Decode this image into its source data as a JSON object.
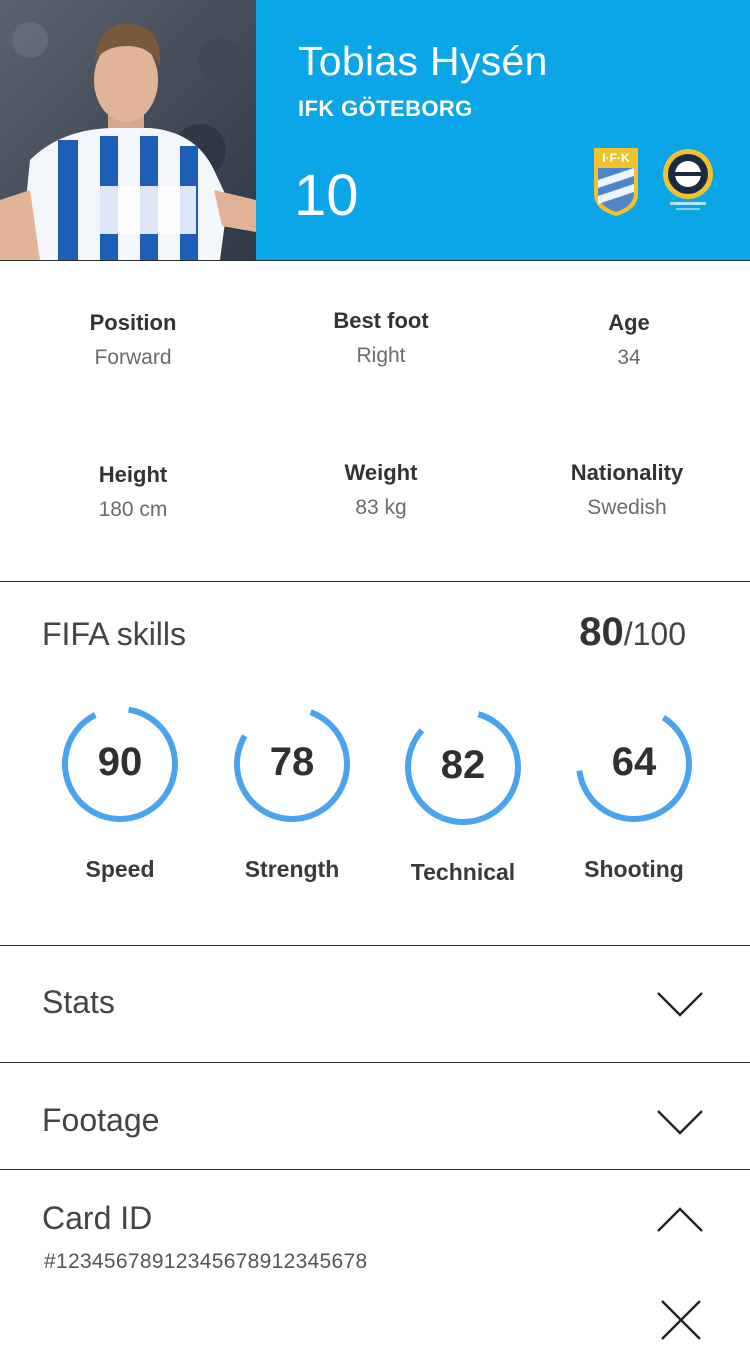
{
  "player": {
    "name": "Tobias Hysén",
    "club": "IFK GÖTEBORG",
    "number": "10",
    "photo_alt": "player-photo",
    "colors": {
      "header": "#0aa6e8",
      "accent": "#4aa3ee"
    }
  },
  "info": [
    {
      "label": "Position",
      "value": "Forward"
    },
    {
      "label": "Best foot",
      "value": "Right"
    },
    {
      "label": "Age",
      "value": "34"
    },
    {
      "label": "Height",
      "value": "180 cm"
    },
    {
      "label": "Weight",
      "value": "83 kg"
    },
    {
      "label": "Nationality",
      "value": "Swedish"
    }
  ],
  "skills": {
    "title": "FIFA skills",
    "total": "80",
    "max": "/100",
    "items": [
      {
        "label": "Speed",
        "value": "90",
        "level": 0.9
      },
      {
        "label": "Strength",
        "value": "78",
        "level": 0.78
      },
      {
        "label": "Technical",
        "value": "82",
        "level": 0.82
      },
      {
        "label": "Shooting",
        "value": "64",
        "level": 0.64
      }
    ]
  },
  "sections": {
    "stats": {
      "title": "Stats",
      "icon": "chevron-down-icon"
    },
    "footage": {
      "title": "Footage",
      "icon": "chevron-down-icon"
    },
    "card_id": {
      "title": "Card ID",
      "icon": "chevron-up-icon",
      "value": "#12345678912345678912345678"
    }
  },
  "close_icon": "close-icon"
}
